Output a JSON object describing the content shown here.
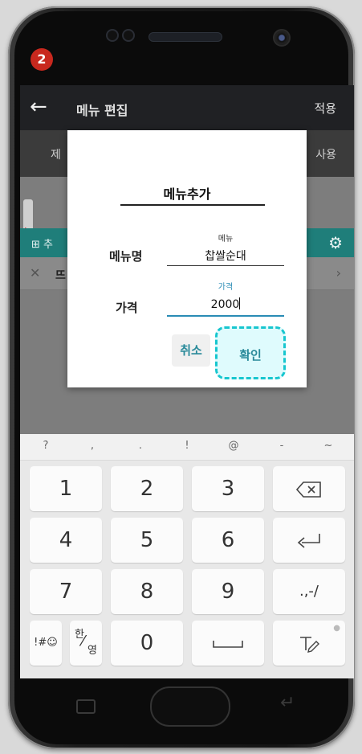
{
  "step_badge": "2",
  "app": {
    "title": "메뉴 편집",
    "apply_label": "적용",
    "tab_left_partial": "제",
    "tab_right_partial": "사용",
    "add_partial": "추",
    "list_item_partial": "뜨",
    "back_icon": "arrow-left-icon",
    "gear_icon": "gear-icon"
  },
  "dialog": {
    "title": "메뉴추가",
    "name_label": "메뉴명",
    "name_float_label": "메뉴",
    "name_value": "찹쌀순대",
    "price_label": "가격",
    "price_float_label": "가격",
    "price_value": "2000",
    "cancel_label": "취소",
    "ok_label": "확인",
    "accent_color": "#2a8cb5",
    "highlight_color": "#17c6cf"
  },
  "keyboard": {
    "symbols": [
      "?",
      ",",
      ".",
      "!",
      "@",
      "-",
      "~"
    ],
    "rows": [
      [
        "1",
        "2",
        "3"
      ],
      [
        "4",
        "5",
        "6"
      ],
      [
        "7",
        "8",
        "9"
      ]
    ],
    "zero": "0",
    "sym_key": "!#☺",
    "lang_key_top": "한",
    "lang_key_bottom": "영",
    "punct_key": ".,-/",
    "backspace_icon": "backspace-icon",
    "enter_icon": "enter-icon",
    "space_icon": "space-icon",
    "handwriting_icon": "handwriting-icon"
  }
}
